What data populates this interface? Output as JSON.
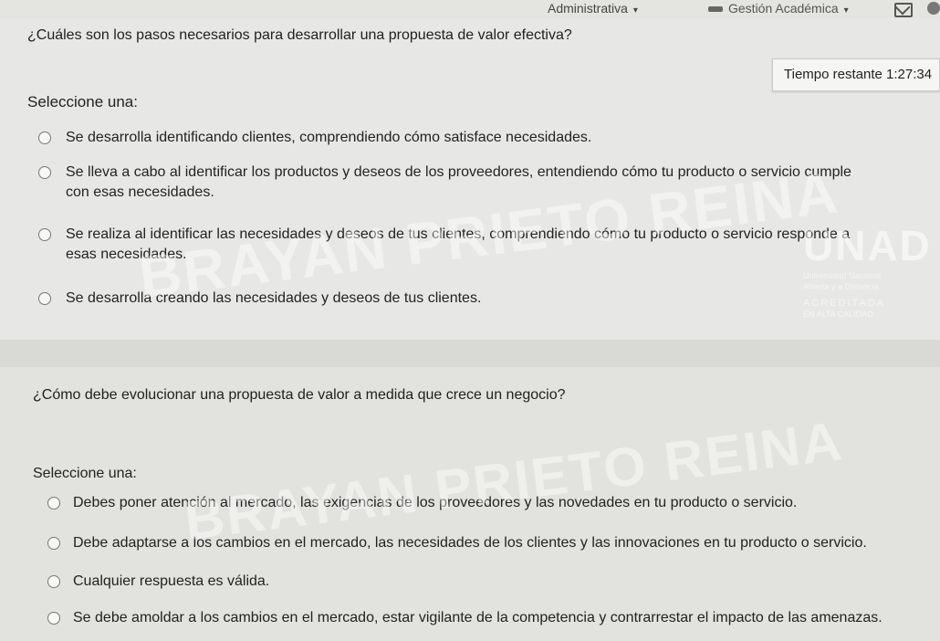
{
  "topbar": {
    "admin_label": "Administrativa",
    "gestion_label": "Gestión Académica"
  },
  "timer": {
    "label": "Tiempo restante",
    "value": "1:27:34"
  },
  "question1": {
    "text": "¿Cuáles son los pasos necesarios para desarrollar una propuesta de valor efectiva?",
    "prompt": "Seleccione una:",
    "options": [
      {
        "line1": "Se desarrolla identificando clientes, comprendiendo cómo satisface necesidades.",
        "line2": ""
      },
      {
        "line1": "Se lleva a cabo al identificar los productos y deseos de los proveedores, entendiendo cómo tu producto o servicio cumple",
        "line2": "con esas necesidades."
      },
      {
        "line1": "Se realiza al identificar las necesidades y deseos de tus clientes, comprendiendo cómo tu producto o servicio responde a",
        "line2": "esas necesidades."
      },
      {
        "line1": "Se desarrolla creando las necesidades y deseos de tus clientes.",
        "line2": ""
      }
    ]
  },
  "question2": {
    "text": "¿Cómo debe evolucionar una propuesta de valor a medida que crece un negocio?",
    "prompt": "Seleccione una:",
    "options": [
      "Debes poner atención al mercado, las exigencias de los proveedores y las novedades en tu producto o servicio.",
      "Debe adaptarse a los cambios en el mercado, las necesidades de los clientes y las innovaciones en tu producto o servicio.",
      "Cualquier respuesta es válida.",
      "Se debe amoldar a los cambios en el mercado, estar vigilante de la competencia y contrarrestar el impacto de las amenazas."
    ]
  },
  "watermark": {
    "line1": "BRAYAN PRIETO REINA",
    "line2": "BRAYAN PRIETO REINA"
  },
  "logo": {
    "mark": "UNAD",
    "line1": "Universidad Nacional",
    "line2": "Abierta y a Distancia",
    "accredited": "ACREDITADA",
    "quality": "EN ALTA CALIDAD"
  }
}
